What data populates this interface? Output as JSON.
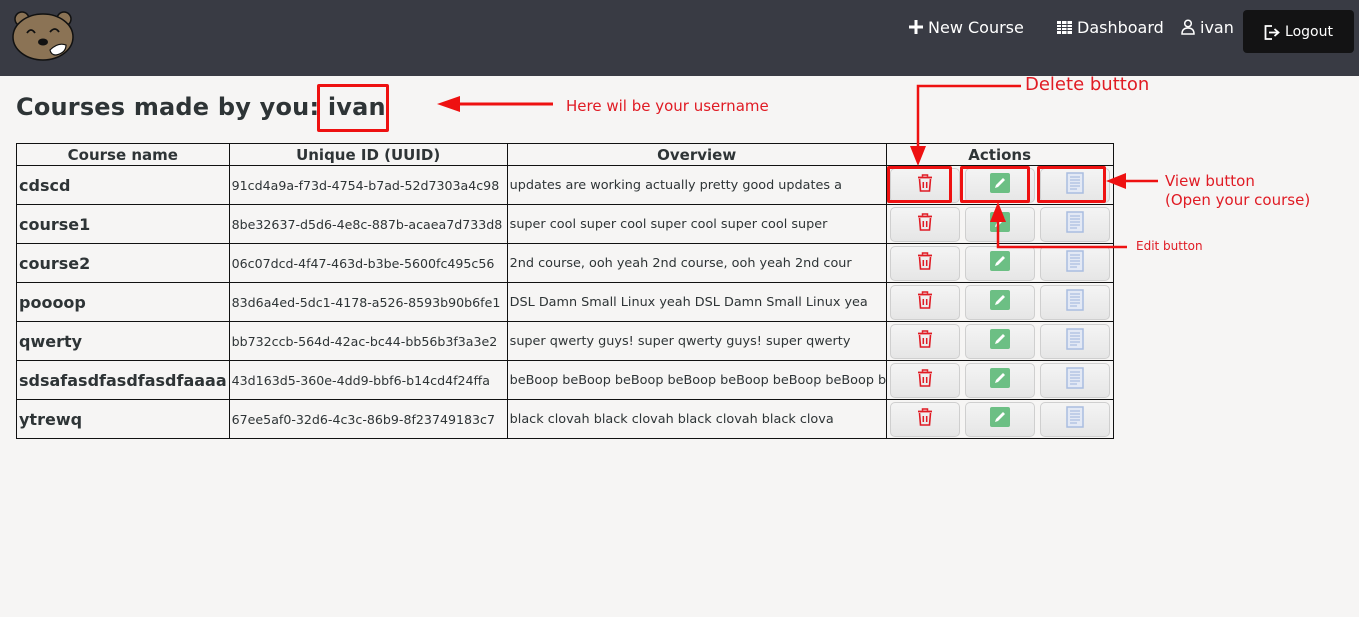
{
  "navbar": {
    "logo": "bear-logo",
    "new_course_label": "New Course",
    "dashboard_label": "Dashboard",
    "username": "ivan",
    "logout_label": "Logout"
  },
  "page": {
    "title_prefix": "Courses made by you:",
    "title_username": "ivan"
  },
  "table": {
    "headers": [
      "Course name",
      "Unique ID (UUID)",
      "Overview",
      "Actions"
    ],
    "rows": [
      {
        "name": "cdscd",
        "uuid": "91cd4a9a-f73d-4754-b7ad-52d7303a4c98",
        "overview": "updates are working actually pretty good updates a"
      },
      {
        "name": "course1",
        "uuid": "8be32637-d5d6-4e8c-887b-acaea7d733d8",
        "overview": "super cool super cool super cool super cool super"
      },
      {
        "name": "course2",
        "uuid": "06c07dcd-4f47-463d-b3be-5600fc495c56",
        "overview": "2nd course, ooh yeah 2nd course, ooh yeah 2nd cour"
      },
      {
        "name": "poooop",
        "uuid": "83d6a4ed-5dc1-4178-a526-8593b90b6fe1",
        "overview": "DSL Damn Small Linux yeah DSL Damn Small Linux yea"
      },
      {
        "name": "qwerty",
        "uuid": "bb732ccb-564d-42ac-bc44-bb56b3f3a3e2",
        "overview": "super qwerty guys! super qwerty guys! super qwerty"
      },
      {
        "name": "sdsafasdfasdfasdfaaaa",
        "uuid": "43d163d5-360e-4dd9-bbf6-b14cd4f24ffa",
        "overview": "beBoop beBoop beBoop beBoop beBoop beBoop beBoop b"
      },
      {
        "name": "ytrewq",
        "uuid": "67ee5af0-32d6-4c3c-86b9-8f23749183c7",
        "overview": "black clovah black clovah black clovah black clova"
      }
    ],
    "action_icons": [
      "trash-icon",
      "pencil-icon",
      "document-icon"
    ]
  },
  "annotations": {
    "username_note": "Here wil be your username",
    "delete_note": "Delete button",
    "view_note_line1": "View button",
    "view_note_line2": "(Open your course)",
    "edit_note": "Edit button"
  },
  "colors": {
    "navbar_bg": "#393b44",
    "logout_bg": "#131314",
    "page_bg": "#f6f5f4",
    "annotation_red": "#e01b24",
    "delete_red": "#e01b24",
    "edit_green": "#6cbf84",
    "view_blue": "#a9bde0"
  }
}
